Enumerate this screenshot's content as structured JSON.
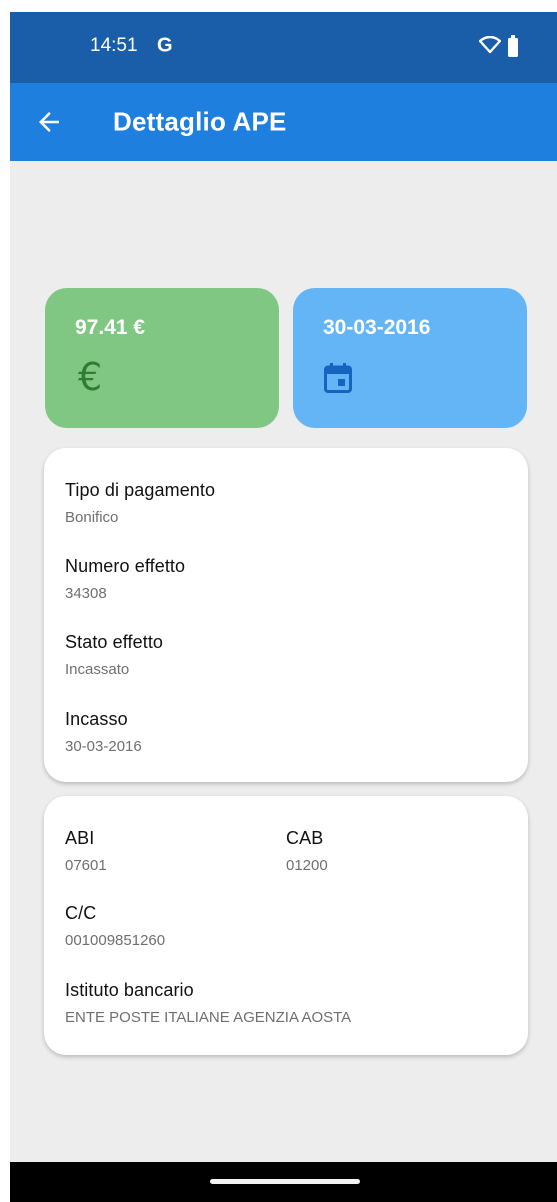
{
  "status_bar": {
    "time": "14:51",
    "g_label": "G"
  },
  "app_bar": {
    "title": "Dettaglio APE"
  },
  "tiles": {
    "amount": "97.41 €",
    "amount_icon": "€",
    "date": "30-03-2016"
  },
  "payment_card": {
    "fields": [
      {
        "label": "Tipo di pagamento",
        "value": "Bonifico"
      },
      {
        "label": "Numero effetto",
        "value": "34308"
      },
      {
        "label": "Stato effetto",
        "value": "Incassato"
      },
      {
        "label": "Incasso",
        "value": "30-03-2016"
      }
    ]
  },
  "bank_card": {
    "abi": {
      "label": "ABI",
      "value": "07601"
    },
    "cab": {
      "label": "CAB",
      "value": "01200"
    },
    "cc": {
      "label": "C/C",
      "value": "001009851260"
    },
    "istituto": {
      "label": "Istituto bancario",
      "value": "ENTE POSTE ITALIANE AGENZIA AOSTA"
    }
  },
  "colors": {
    "status_bar": "#1a5ea9",
    "app_bar": "#1e7fde",
    "amount_tile": "#81c784",
    "euro_icon": "#2e7d32",
    "date_tile": "#64b5f6",
    "calendar_icon": "#1565c0",
    "background": "#ededed"
  },
  "icons": {
    "back": "arrow-back-icon",
    "amount": "euro-icon",
    "date": "calendar-icon",
    "wifi": "wifi-icon",
    "battery": "battery-icon"
  }
}
